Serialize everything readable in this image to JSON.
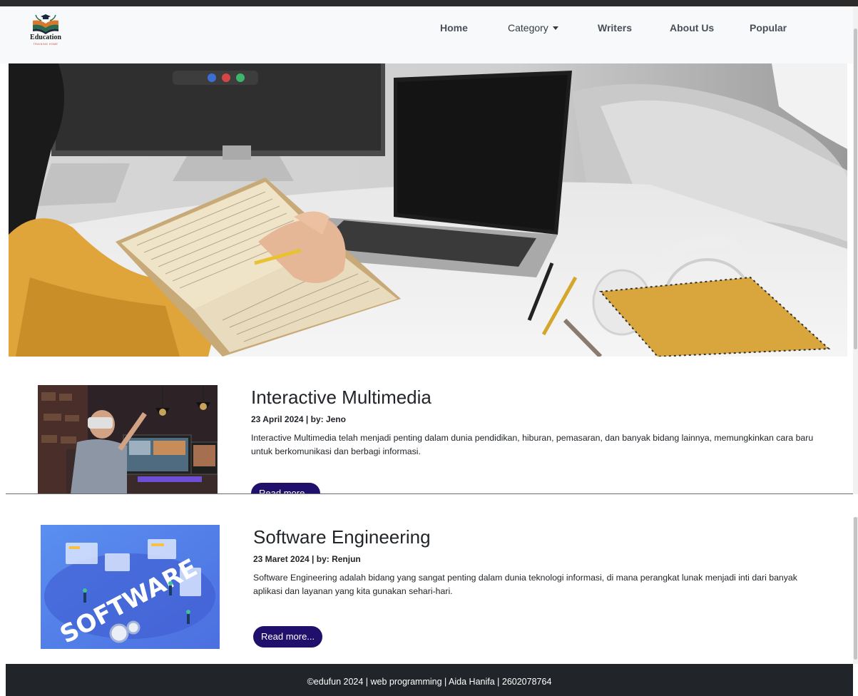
{
  "navbar": {
    "logo_text": "Education",
    "logo_subtext": "TRAINING HOME",
    "links": {
      "home": "Home",
      "category": "Category",
      "writers": "Writers",
      "about": "About Us",
      "popular": "Popular"
    }
  },
  "hero": {
    "icon": "hero-photo-woman-reading-book-at-desk"
  },
  "articles": [
    {
      "title": "Interactive Multimedia",
      "meta": "23 April 2024 | by: Jeno",
      "description": "Interactive Multimedia telah menjadi penting dalam dunia pendidikan, hiburan, pemasaran, dan banyak bidang lainnya, memungkinkan cara baru untuk berkomunikasi dan berbagi informasi.",
      "button": "Read more...",
      "thumbnail": "vr-multimedia-photo"
    },
    {
      "title": "Software Engineering",
      "meta": "23 Maret 2024 | by: Renjun",
      "description": "Software Engineering adalah bidang yang sangat penting dalam dunia teknologi informasi, di mana perangkat lunak menjadi inti dari banyak aplikasi dan layanan yang kita gunakan sehari-hari.",
      "button": "Read more...",
      "thumbnail": "software-isometric-illustration",
      "illustration_text": "SOFTWARE"
    }
  ],
  "footer": {
    "text": "©edufun 2024 | web programming | Aida Hanifa | 2602078764"
  },
  "colors": {
    "button": "#21106b",
    "footer": "#212529",
    "navbar": "#f8f9fa"
  }
}
